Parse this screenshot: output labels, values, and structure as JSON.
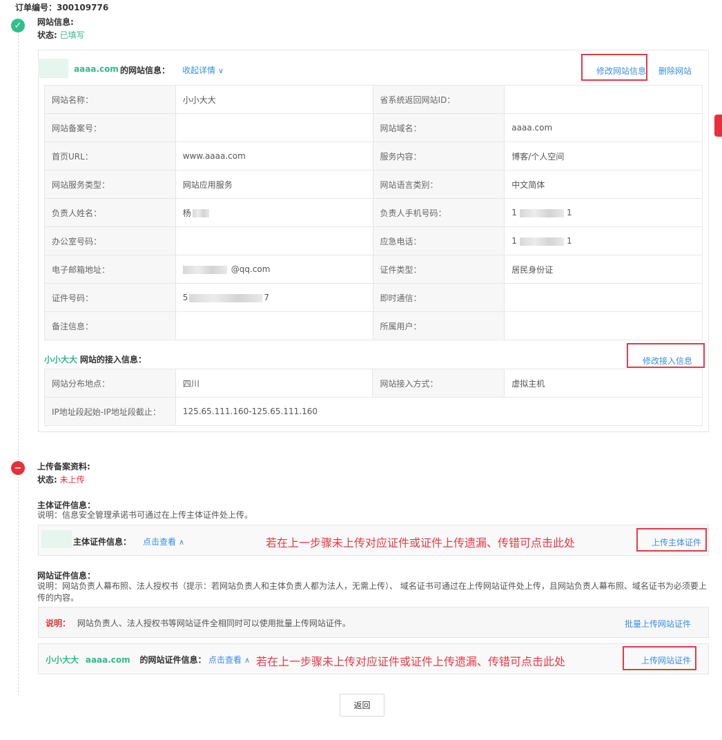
{
  "order": {
    "label": "订单编号：",
    "number": "300109776"
  },
  "section1": {
    "title": "网站信息:",
    "status_label": "状态:",
    "status_value": "已填写",
    "site_domain": "aaaa.com",
    "site_info_label": "的网站信息：",
    "collapse_link": "收起详情",
    "edit_button": "修改网站信息",
    "delete_button": "删除网站",
    "rows": [
      {
        "k1": "网站名称：",
        "v1": "小小大大",
        "k2": "省系统返回网站ID：",
        "v2": ""
      },
      {
        "k1": "网站备案号：",
        "v1": "",
        "k2": "网站域名：",
        "v2": "aaaa.com"
      },
      {
        "k1": "首页URL：",
        "v1": "www.aaaa.com",
        "k2": "服务内容：",
        "v2": "博客/个人空间"
      },
      {
        "k1": "网站服务类型：",
        "v1": "网站应用服务",
        "k2": "网站语言类别：",
        "v2": "中文简体"
      },
      {
        "k1": "负责人姓名：",
        "v1": "杨",
        "k2": "负责人手机号码：",
        "v2": "1",
        "v2_end": "1"
      },
      {
        "k1": "办公室号码：",
        "v1": "",
        "k2": "应急电话：",
        "v2": "1",
        "v2_end": "1"
      },
      {
        "k1": "电子邮箱地址：",
        "v1": "@qq.com",
        "k2": "证件类型：",
        "v2": "居民身份证"
      },
      {
        "k1": "证件号码：",
        "v1": "5",
        "v1_end": "7",
        "k2": "即时通信：",
        "v2": ""
      },
      {
        "k1": "备注信息：",
        "v1": "",
        "k2": "所属用户：",
        "v2": ""
      }
    ],
    "access_site_name": "小小大大",
    "access_label": "网站的接入信息：",
    "edit_access_button": "修改接入信息",
    "access_rows": [
      {
        "k1": "网站分布地点：",
        "v1": "四川",
        "k2": "网站接入方式：",
        "v2": "虚拟主机"
      },
      {
        "k1": "IP地址段起始-IP地址段截止：",
        "v1": "125.65.111.160-125.65.111.160"
      }
    ]
  },
  "section2": {
    "title": "上传备案资料:",
    "status_label": "状态:",
    "status_value": "未上传",
    "subject_title": "主体证件信息：",
    "subject_desc": "说明：信息安全管理承诺书可通过在上传主体证件处上传。",
    "subject_panel_label": "主体证件信息：",
    "subject_view_link": "点击查看",
    "subject_annotation": "若在上一步骤未上传对应证件或证件上传遗漏、传错可点击此处",
    "subject_upload_button": "上传主体证件",
    "site_cert_title": "网站证件信息：",
    "site_cert_desc": "说明：网站负责人幕布照、法人授权书（提示：若网站负责人和主体负责人都为法人，无需上传）、 域名证书可通过在上传网站证件处上传，且网站负责人幕布照、域名证书为必须要上传的内容。",
    "note_label": "说明：",
    "note_text": "网站负责人、法人授权书等网站证件全相同时可以使用批量上传网站证件。",
    "batch_upload_link": "批量上传网站证件",
    "cert_site_name": "小小大大",
    "cert_site_domain": "aaaa.com",
    "cert_label": "的网站证件信息：",
    "cert_view_link": "点击查看",
    "cert_annotation": "若在上一步骤未上传对应证件或证件上传遗漏、传错可点击此处",
    "cert_upload_button": "上传网站证件"
  },
  "footer": {
    "back_button": "返回"
  },
  "colors": {
    "green": "#2fba8c",
    "red": "#e8303a",
    "blue": "#3a8ee6",
    "annotation_red": "#e23a46"
  }
}
